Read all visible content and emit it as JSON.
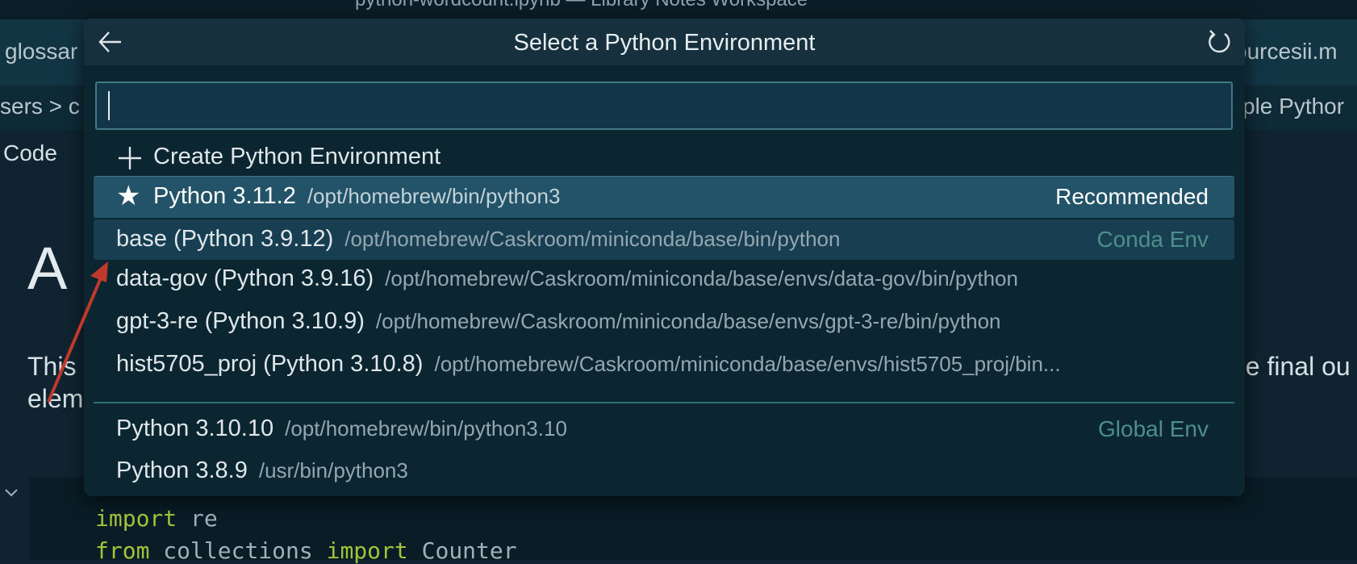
{
  "background": {
    "window_title": "python-wordcount.ipynb — Library Notes Workspace",
    "tab_left": "glossar",
    "tab_right": "ourcesii.m",
    "breadcrumb_left": "sers > c",
    "breadcrumb_right": "ple Pythor",
    "code_label": "Code",
    "heading": "A",
    "para_line1": "This",
    "para_line2": "elem",
    "para_right": "he final ou",
    "code": {
      "line1_kw": "import",
      "line1_rest": " re",
      "line2_kw1": "from",
      "line2_mod": " collections ",
      "line2_kw2": "import",
      "line2_rest": " Counter"
    }
  },
  "quickpick": {
    "title": "Select a Python Environment",
    "input_value": "",
    "create_label": "Create Python Environment",
    "items": [
      {
        "name": "Python 3.11.2",
        "path": "/opt/homebrew/bin/python3",
        "tag": "Recommended"
      },
      {
        "name": "base (Python 3.9.12)",
        "path": "/opt/homebrew/Caskroom/miniconda/base/bin/python",
        "tag": "Conda Env"
      },
      {
        "name": "data-gov (Python 3.9.16)",
        "path": "/opt/homebrew/Caskroom/miniconda/base/envs/data-gov/bin/python",
        "tag": ""
      },
      {
        "name": "gpt-3-re (Python 3.10.9)",
        "path": "/opt/homebrew/Caskroom/miniconda/base/envs/gpt-3-re/bin/python",
        "tag": ""
      },
      {
        "name": "hist5705_proj (Python 3.10.8)",
        "path": "/opt/homebrew/Caskroom/miniconda/base/envs/hist5705_proj/bin...",
        "tag": ""
      },
      {
        "name": "Python 3.10.10",
        "path": "/opt/homebrew/bin/python3.10",
        "tag": "Global Env"
      },
      {
        "name": "Python 3.8.9",
        "path": "/usr/bin/python3",
        "tag": ""
      }
    ]
  },
  "colors": {
    "accent_selected": "#225368",
    "env_tag": "#4c8f8b",
    "annotation_arrow": "#c0392b"
  }
}
